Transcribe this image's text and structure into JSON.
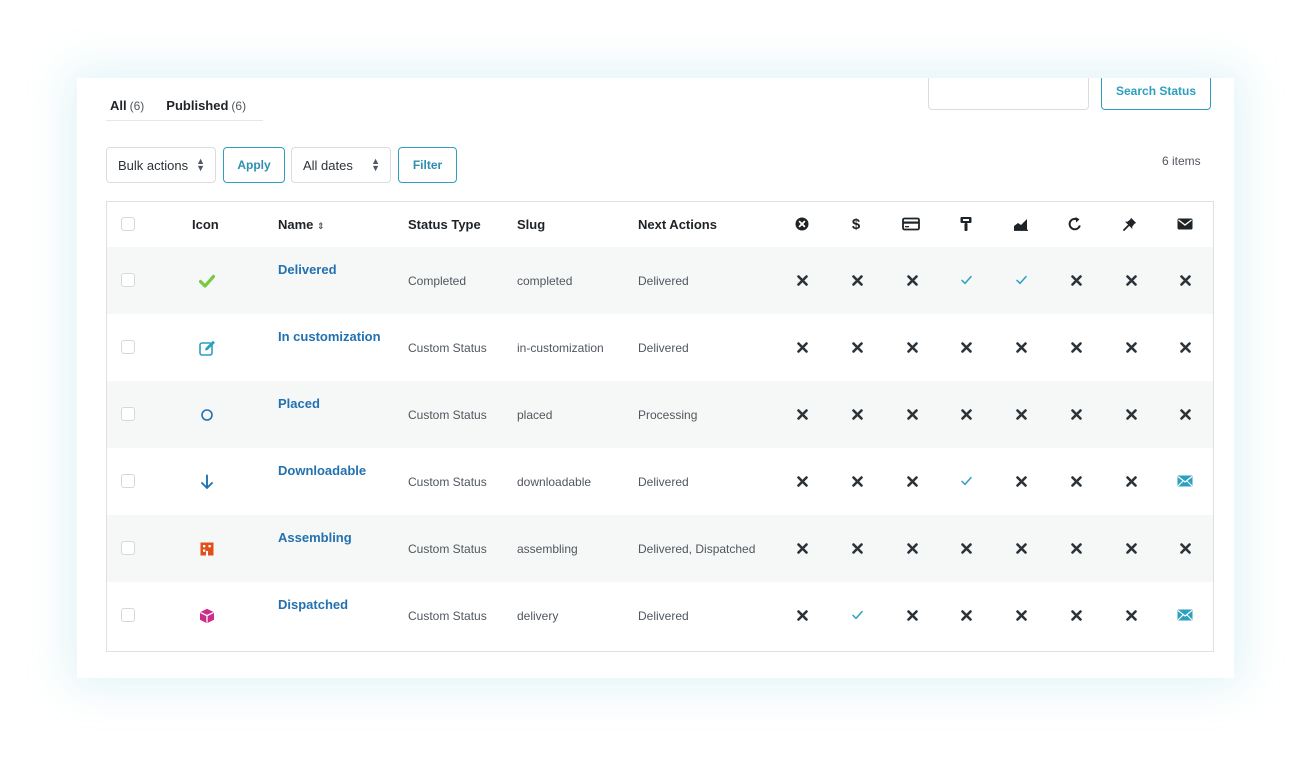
{
  "views": [
    {
      "label": "All",
      "count": "(6)"
    },
    {
      "label": "Published",
      "count": "(6)"
    }
  ],
  "search": {
    "placeholder": "",
    "button_label": "Search Status"
  },
  "toolbar": {
    "bulk_actions": "Bulk actions",
    "apply": "Apply",
    "dates": "All dates",
    "filter": "Filter",
    "items_count": "6 items"
  },
  "table": {
    "columns": {
      "icon": "Icon",
      "name": "Name",
      "status_type": "Status Type",
      "slug": "Slug",
      "next_actions": "Next Actions"
    },
    "flag_columns": [
      "cancel-circle-icon",
      "dollar-icon",
      "credit-card-icon",
      "paint-brush-icon",
      "chart-area-icon",
      "refresh-icon",
      "pin-icon",
      "email-icon"
    ],
    "rows": [
      {
        "name": "Delivered",
        "status_type": "Completed",
        "slug": "completed",
        "next_actions": "Delivered",
        "icon": "check-icon",
        "icon_color": "#7ac943",
        "flags": [
          "x",
          "x",
          "x",
          "check",
          "check",
          "x",
          "x",
          "x"
        ]
      },
      {
        "name": "In customization",
        "status_type": "Custom Status",
        "slug": "in-customization",
        "next_actions": "Delivered",
        "icon": "edit-icon",
        "icon_color": "#2d9fbf",
        "flags": [
          "x",
          "x",
          "x",
          "x",
          "x",
          "x",
          "x",
          "x"
        ]
      },
      {
        "name": "Placed",
        "status_type": "Custom Status",
        "slug": "placed",
        "next_actions": "Processing",
        "icon": "circle-icon",
        "icon_color": "#2271b1",
        "flags": [
          "x",
          "x",
          "x",
          "x",
          "x",
          "x",
          "x",
          "x"
        ]
      },
      {
        "name": "Downloadable",
        "status_type": "Custom Status",
        "slug": "downloadable",
        "next_actions": "Delivered",
        "icon": "arrow-down-icon",
        "icon_color": "#2271b1",
        "flags": [
          "x",
          "x",
          "x",
          "check",
          "x",
          "x",
          "x",
          "mail"
        ]
      },
      {
        "name": "Assembling",
        "status_type": "Custom Status",
        "slug": "assembling",
        "next_actions": "Delivered, Dispatched",
        "icon": "building-icon",
        "icon_color": "#e0501b",
        "flags": [
          "x",
          "x",
          "x",
          "x",
          "x",
          "x",
          "x",
          "x"
        ]
      },
      {
        "name": "Dispatched",
        "status_type": "Custom Status",
        "slug": "delivery",
        "next_actions": "Delivered",
        "icon": "cube-icon",
        "icon_color": "#cc2d8a",
        "flags": [
          "x",
          "check",
          "x",
          "x",
          "x",
          "x",
          "x",
          "mail"
        ]
      }
    ]
  },
  "colors": {
    "accent": "#2d9fbf",
    "link": "#2271b1",
    "mark": "#2c3338",
    "check": "#2d9fbf"
  }
}
